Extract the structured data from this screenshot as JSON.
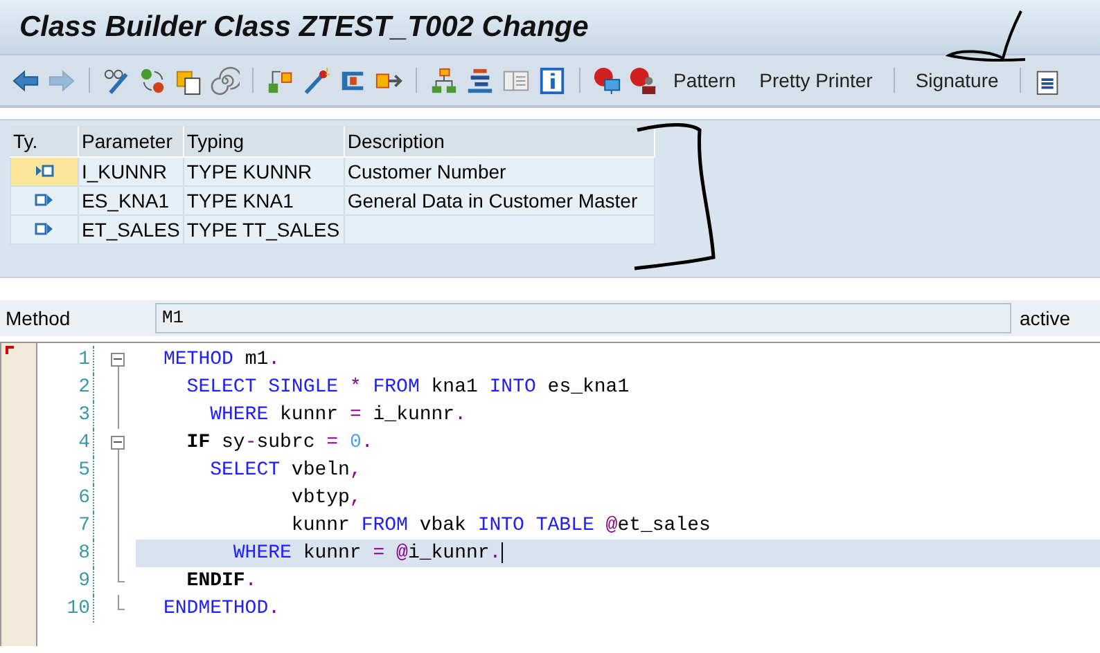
{
  "window": {
    "title": "Class Builder Class ZTEST_T002 Change"
  },
  "toolbar": {
    "back": {
      "disabled": false
    },
    "forward": {
      "disabled": true
    },
    "buttons": [
      "Pattern",
      "Pretty Printer",
      "Signature"
    ]
  },
  "parameters": {
    "columns": [
      "Ty.",
      "Parameter",
      "Typing",
      "Description"
    ],
    "rows": [
      {
        "kind": "importing",
        "selected": true,
        "cells": [
          "",
          "I_KUNNR",
          "TYPE KUNNR",
          "Customer Number"
        ]
      },
      {
        "kind": "exporting",
        "selected": false,
        "cells": [
          "",
          "ES_KNA1",
          "TYPE KNA1",
          "General Data in Customer Master"
        ]
      },
      {
        "kind": "exporting",
        "selected": false,
        "cells": [
          "",
          "ET_SALES",
          "TYPE TT_SALES",
          ""
        ]
      }
    ]
  },
  "method": {
    "label": "Method",
    "value": "M1",
    "status": "active"
  },
  "editor": {
    "lines": [
      {
        "number": "1",
        "kind": "fold-start",
        "selected": false,
        "tokens": [
          {
            "kind": "kw",
            "text": "METHOD"
          },
          {
            "kind": "id",
            "text": " m1"
          },
          {
            "kind": "op",
            "text": "."
          }
        ]
      },
      {
        "number": "2",
        "kind": "plain",
        "selected": false,
        "tokens": [
          {
            "kind": "kw",
            "text": "  SELECT SINGLE"
          },
          {
            "kind": "op",
            "text": " *"
          },
          {
            "kind": "kw",
            "text": " FROM"
          },
          {
            "kind": "id",
            "text": " kna1"
          },
          {
            "kind": "kw",
            "text": " INTO"
          },
          {
            "kind": "id",
            "text": " es_kna1"
          }
        ]
      },
      {
        "number": "3",
        "kind": "plain",
        "selected": false,
        "tokens": [
          {
            "kind": "kw",
            "text": "    WHERE"
          },
          {
            "kind": "id",
            "text": " kunnr"
          },
          {
            "kind": "op",
            "text": " ="
          },
          {
            "kind": "id",
            "text": " i_kunnr"
          },
          {
            "kind": "op",
            "text": "."
          }
        ]
      },
      {
        "number": "4",
        "kind": "fold-start",
        "selected": false,
        "tokens": [
          {
            "kind": "bold",
            "text": "  IF"
          },
          {
            "kind": "id",
            "text": " sy"
          },
          {
            "kind": "op",
            "text": "-"
          },
          {
            "kind": "id",
            "text": "subrc"
          },
          {
            "kind": "op",
            "text": " ="
          },
          {
            "kind": "num",
            "text": " 0"
          },
          {
            "kind": "op",
            "text": "."
          }
        ]
      },
      {
        "number": "5",
        "kind": "plain",
        "selected": false,
        "tokens": [
          {
            "kind": "kw",
            "text": "    SELECT"
          },
          {
            "kind": "id",
            "text": " vbeln"
          },
          {
            "kind": "op",
            "text": ","
          }
        ]
      },
      {
        "number": "6",
        "kind": "plain",
        "selected": false,
        "tokens": [
          {
            "kind": "id",
            "text": "           vbtyp"
          },
          {
            "kind": "op",
            "text": ","
          }
        ]
      },
      {
        "number": "7",
        "kind": "plain",
        "selected": false,
        "tokens": [
          {
            "kind": "id",
            "text": "           kunnr"
          },
          {
            "kind": "kw",
            "text": " FROM"
          },
          {
            "kind": "id",
            "text": " vbak"
          },
          {
            "kind": "kw",
            "text": " INTO TABLE"
          },
          {
            "kind": "op",
            "text": " @"
          },
          {
            "kind": "id",
            "text": "et_sales"
          }
        ]
      },
      {
        "number": "8",
        "kind": "plain",
        "selected": true,
        "tokens": [
          {
            "kind": "kw",
            "text": "      WHERE"
          },
          {
            "kind": "id",
            "text": " kunnr"
          },
          {
            "kind": "op",
            "text": " ="
          },
          {
            "kind": "op",
            "text": " @"
          },
          {
            "kind": "id",
            "text": "i_kunnr"
          },
          {
            "kind": "op",
            "text": "."
          }
        ]
      },
      {
        "number": "9",
        "kind": "fold-end",
        "selected": false,
        "tokens": [
          {
            "kind": "bold",
            "text": "  ENDIF"
          },
          {
            "kind": "op",
            "text": "."
          }
        ]
      },
      {
        "number": "10",
        "kind": "fold-end",
        "selected": false,
        "tokens": [
          {
            "kind": "kw",
            "text": "ENDMETHOD"
          },
          {
            "kind": "op",
            "text": "."
          }
        ]
      }
    ]
  }
}
